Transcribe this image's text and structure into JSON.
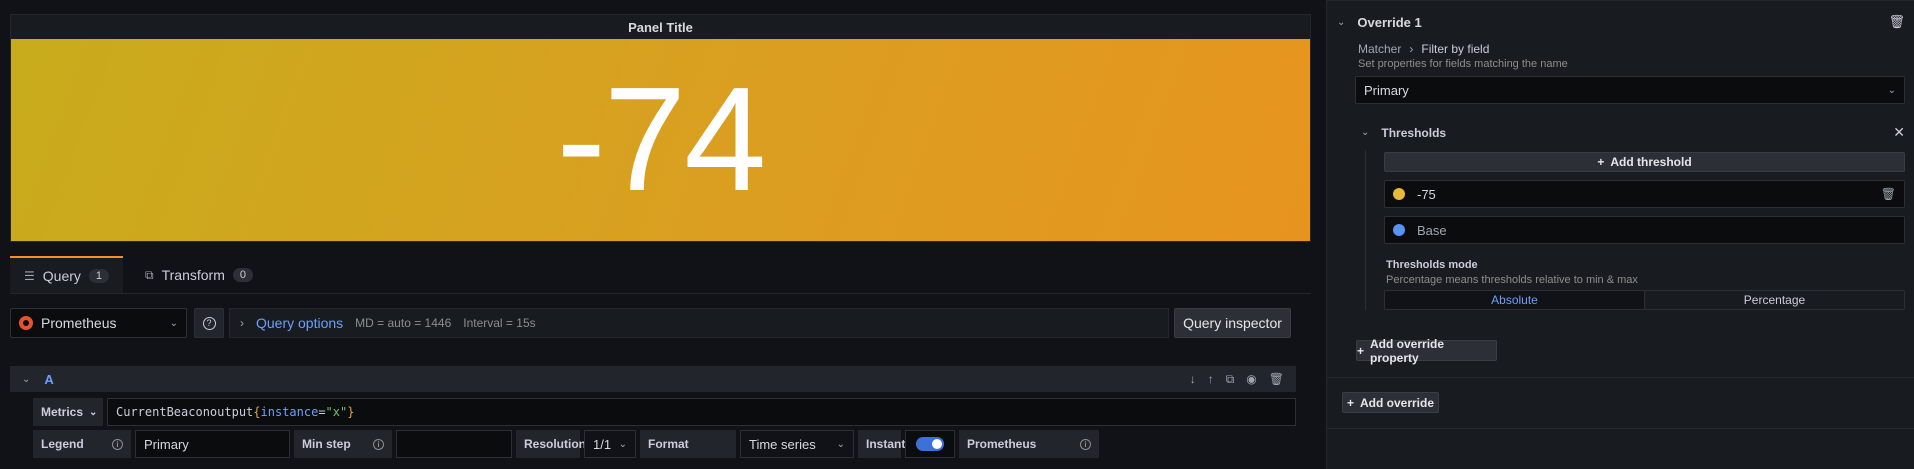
{
  "panel": {
    "title": "Panel Title",
    "stat_value": "-74"
  },
  "tabs": [
    {
      "label": "Query",
      "count": "1"
    },
    {
      "label": "Transform",
      "count": "0"
    }
  ],
  "query_row": {
    "datasource": "Prometheus",
    "options_label": "Query options",
    "md": "MD = auto = 1446",
    "interval": "Interval = 15s",
    "inspector_label": "Query inspector"
  },
  "query": {
    "ref_id": "A",
    "metrics_label": "Metrics",
    "expr": {
      "metric": "CurrentBeaconoutput",
      "open": "{",
      "label_key": "instance",
      "eq": "=",
      "label_val": "\"x\"",
      "close": "}"
    },
    "legend_label": "Legend",
    "legend_value": "Primary",
    "minstep_label": "Min step",
    "minstep_value": "",
    "resolution_label": "Resolution",
    "resolution_value": "1/1",
    "format_label": "Format",
    "format_value": "Time series",
    "instant_label": "Instant",
    "instant_on": true,
    "footer_ds": "Prometheus"
  },
  "override": {
    "title": "Override 1",
    "matcher_label": "Matcher",
    "matcher_value": "Filter by field",
    "matcher_desc": "Set properties for fields matching the name",
    "field_value": "Primary",
    "thresholds_title": "Thresholds",
    "add_threshold": "Add threshold",
    "thresholds": [
      {
        "value": "-75",
        "color": "#eab839"
      },
      {
        "value": "Base",
        "color": "#5794f2"
      }
    ],
    "mode_title": "Thresholds mode",
    "mode_desc": "Percentage means thresholds relative to min & max",
    "mode_options": [
      "Absolute",
      "Percentage"
    ],
    "mode_selected": "Absolute",
    "add_property": "Add override property",
    "add_override": "Add override"
  },
  "colors": {
    "accent": "#6e9fff",
    "active_tab": "#f58e29",
    "stat_start": "#c8ac1c",
    "stat_end": "#e7941f"
  }
}
